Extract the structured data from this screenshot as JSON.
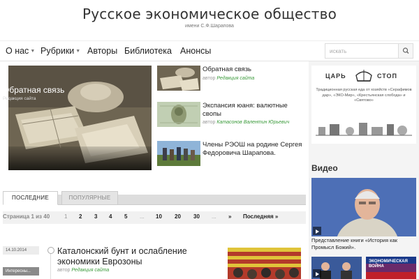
{
  "header": {
    "title": "Русское экономическое общество",
    "subtitle": "имени С.Ф.Шарапова"
  },
  "nav": {
    "items": [
      {
        "label": "О нас",
        "dropdown": true
      },
      {
        "label": "Рубрики",
        "dropdown": true
      },
      {
        "label": "Авторы",
        "dropdown": false
      },
      {
        "label": "Библиотека",
        "dropdown": false
      },
      {
        "label": "Анонсы",
        "dropdown": false
      }
    ],
    "search_placeholder": "искать",
    "search_icon": "search-icon"
  },
  "featured": {
    "hero": {
      "title": "Обратная связь",
      "author": "Редакция сайта"
    },
    "side_posts": [
      {
        "title": "Обратная связь",
        "author_prefix": "автор",
        "author": "Редакция сайта"
      },
      {
        "title": "Экспансия юаня: валютные свопы",
        "author_prefix": "автор",
        "author": "Катасонов Валентин Юрьевич"
      },
      {
        "title": "Члены РЭОШ на родине Сергея Федоровича Шарапова.",
        "author_prefix": "",
        "author": ""
      }
    ]
  },
  "tabs": [
    {
      "label": "ПОСЛЕДНИЕ",
      "active": true
    },
    {
      "label": "ПОПУЛЯРНЫЕ",
      "active": false
    }
  ],
  "pagination": {
    "label": "Страница 1 из 40",
    "pages": [
      "1",
      "2",
      "3",
      "4",
      "5",
      "...",
      "10",
      "20",
      "30",
      "...",
      "»",
      "Последняя »"
    ],
    "current": "1"
  },
  "articles": [
    {
      "date": "14.10.2014",
      "category": "Интересны...",
      "title": "Каталонский бунт и ослабление экономики Еврозоны",
      "author_prefix": "автор",
      "author": "Редакция сайта"
    }
  ],
  "sidebar": {
    "ad": {
      "brand_left": "ЦАРЬ",
      "brand_right": "СТОП",
      "text": "Традиционная русская еда от хозяйств «Серафимов дар», «ЭКО-Мир», «Крестьянская слобода» и «Святово»"
    },
    "video_heading": "Видео",
    "video_caption": "Представление книги «История как Промысл Божий».",
    "small_videos": [
      {
        "label": ""
      },
      {
        "label": "ЭКОНОМИЧЕСКАЯ ВОЙНА"
      }
    ]
  },
  "colors": {
    "author_link": "#3a9a3a",
    "tab_bar": "#dddddd",
    "sidebar_bg": "#f4f4f4"
  }
}
